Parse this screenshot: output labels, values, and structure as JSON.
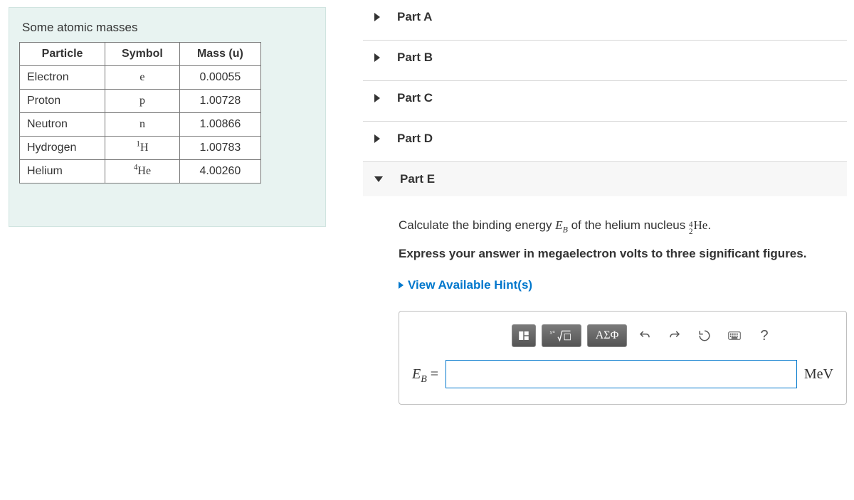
{
  "panel": {
    "title": "Some atomic masses",
    "headers": {
      "particle": "Particle",
      "symbol": "Symbol",
      "mass": "Mass (u)"
    },
    "rows": [
      {
        "particle": "Electron",
        "symbol": "e",
        "mass": "0.00055"
      },
      {
        "particle": "Proton",
        "symbol": "p",
        "mass": "1.00728"
      },
      {
        "particle": "Neutron",
        "symbol": "n",
        "mass": "1.00866"
      },
      {
        "particle": "Hydrogen",
        "symbol": "1H",
        "pre": "1",
        "elem": "H",
        "mass": "1.00783"
      },
      {
        "particle": "Helium",
        "symbol": "4He",
        "pre": "4",
        "elem": "He",
        "mass": "4.00260"
      }
    ]
  },
  "parts": {
    "a": "Part A",
    "b": "Part B",
    "c": "Part C",
    "d": "Part D",
    "e": "Part E"
  },
  "partE": {
    "prompt_prefix": "Calculate the binding energy ",
    "EB": "E",
    "Bsub": "B",
    "prompt_mid": " of the helium nucleus ",
    "he_top": "4",
    "he_bot": "2",
    "he_elem": "He",
    "period": ".",
    "express": "Express your answer in megaelectron volts to three significant figures.",
    "hints": "View Available Hint(s)",
    "lhs_E": "E",
    "lhs_B": "B",
    "equals": " =",
    "unit": "MeV",
    "answer_value": ""
  },
  "toolbar": {
    "templates": "templates-icon",
    "math": "math-root-icon",
    "greek": "ΑΣΦ",
    "undo": "undo-icon",
    "redo": "redo-icon",
    "reset": "reset-icon",
    "keyboard": "keyboard-icon",
    "help": "?"
  }
}
